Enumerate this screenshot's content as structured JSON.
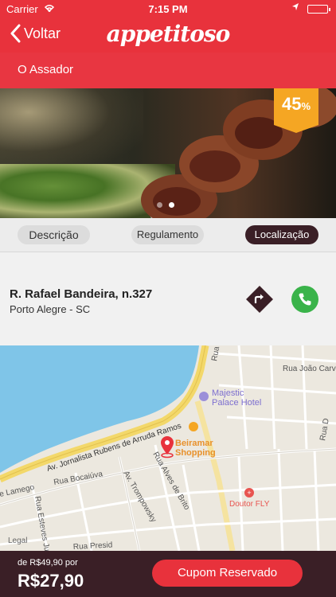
{
  "status_bar": {
    "carrier": "Carrier",
    "time": "7:15 PM"
  },
  "nav": {
    "back_label": "Voltar",
    "logo": "appetitoso"
  },
  "restaurant": {
    "name": "O Assador"
  },
  "hero": {
    "discount_value": "45",
    "discount_unit": "%",
    "slide_count": 2,
    "active_slide": 2
  },
  "tabs": [
    {
      "label": "Descrição",
      "selected": false
    },
    {
      "label": "Regulamento",
      "selected": false
    },
    {
      "label": "Localização",
      "selected": true
    }
  ],
  "location": {
    "street": "R. Rafael Bandeira, n.327",
    "city": "Porto Alegre - SC"
  },
  "map": {
    "labels": {
      "street_joao": "Rua João Carvalho",
      "street_fre": "Rua Fre",
      "hotel": "Majestic Palace Hotel",
      "hotel_line1": "Majestic",
      "hotel_line2": "Palace Hotel",
      "avenue": "Av. Jornalista Rubens de Arruda Ramos",
      "shopping_line1": "Beiramar",
      "shopping_line2": "Shopping",
      "rua_bocaiuva": "Rua Bocaiúva",
      "trompowsky": "Av. Trompowsky",
      "alves_brito": "Rua Alves de Brito",
      "lamego": "e Lamego",
      "esteves": "Rua Esteves Jun",
      "doutor": "Doutor FLY",
      "rua_d": "Rua D",
      "rua_presid": "Rua Presid",
      "legal": "Legal"
    }
  },
  "footer": {
    "old_price": "de R$49,90 por",
    "new_price": "R$27,90",
    "cta": "Cupom Reservado"
  },
  "colors": {
    "brand_red": "#e8323c",
    "dark": "#3a1f26",
    "badge": "#f5a623",
    "call_green": "#3ab34a"
  }
}
